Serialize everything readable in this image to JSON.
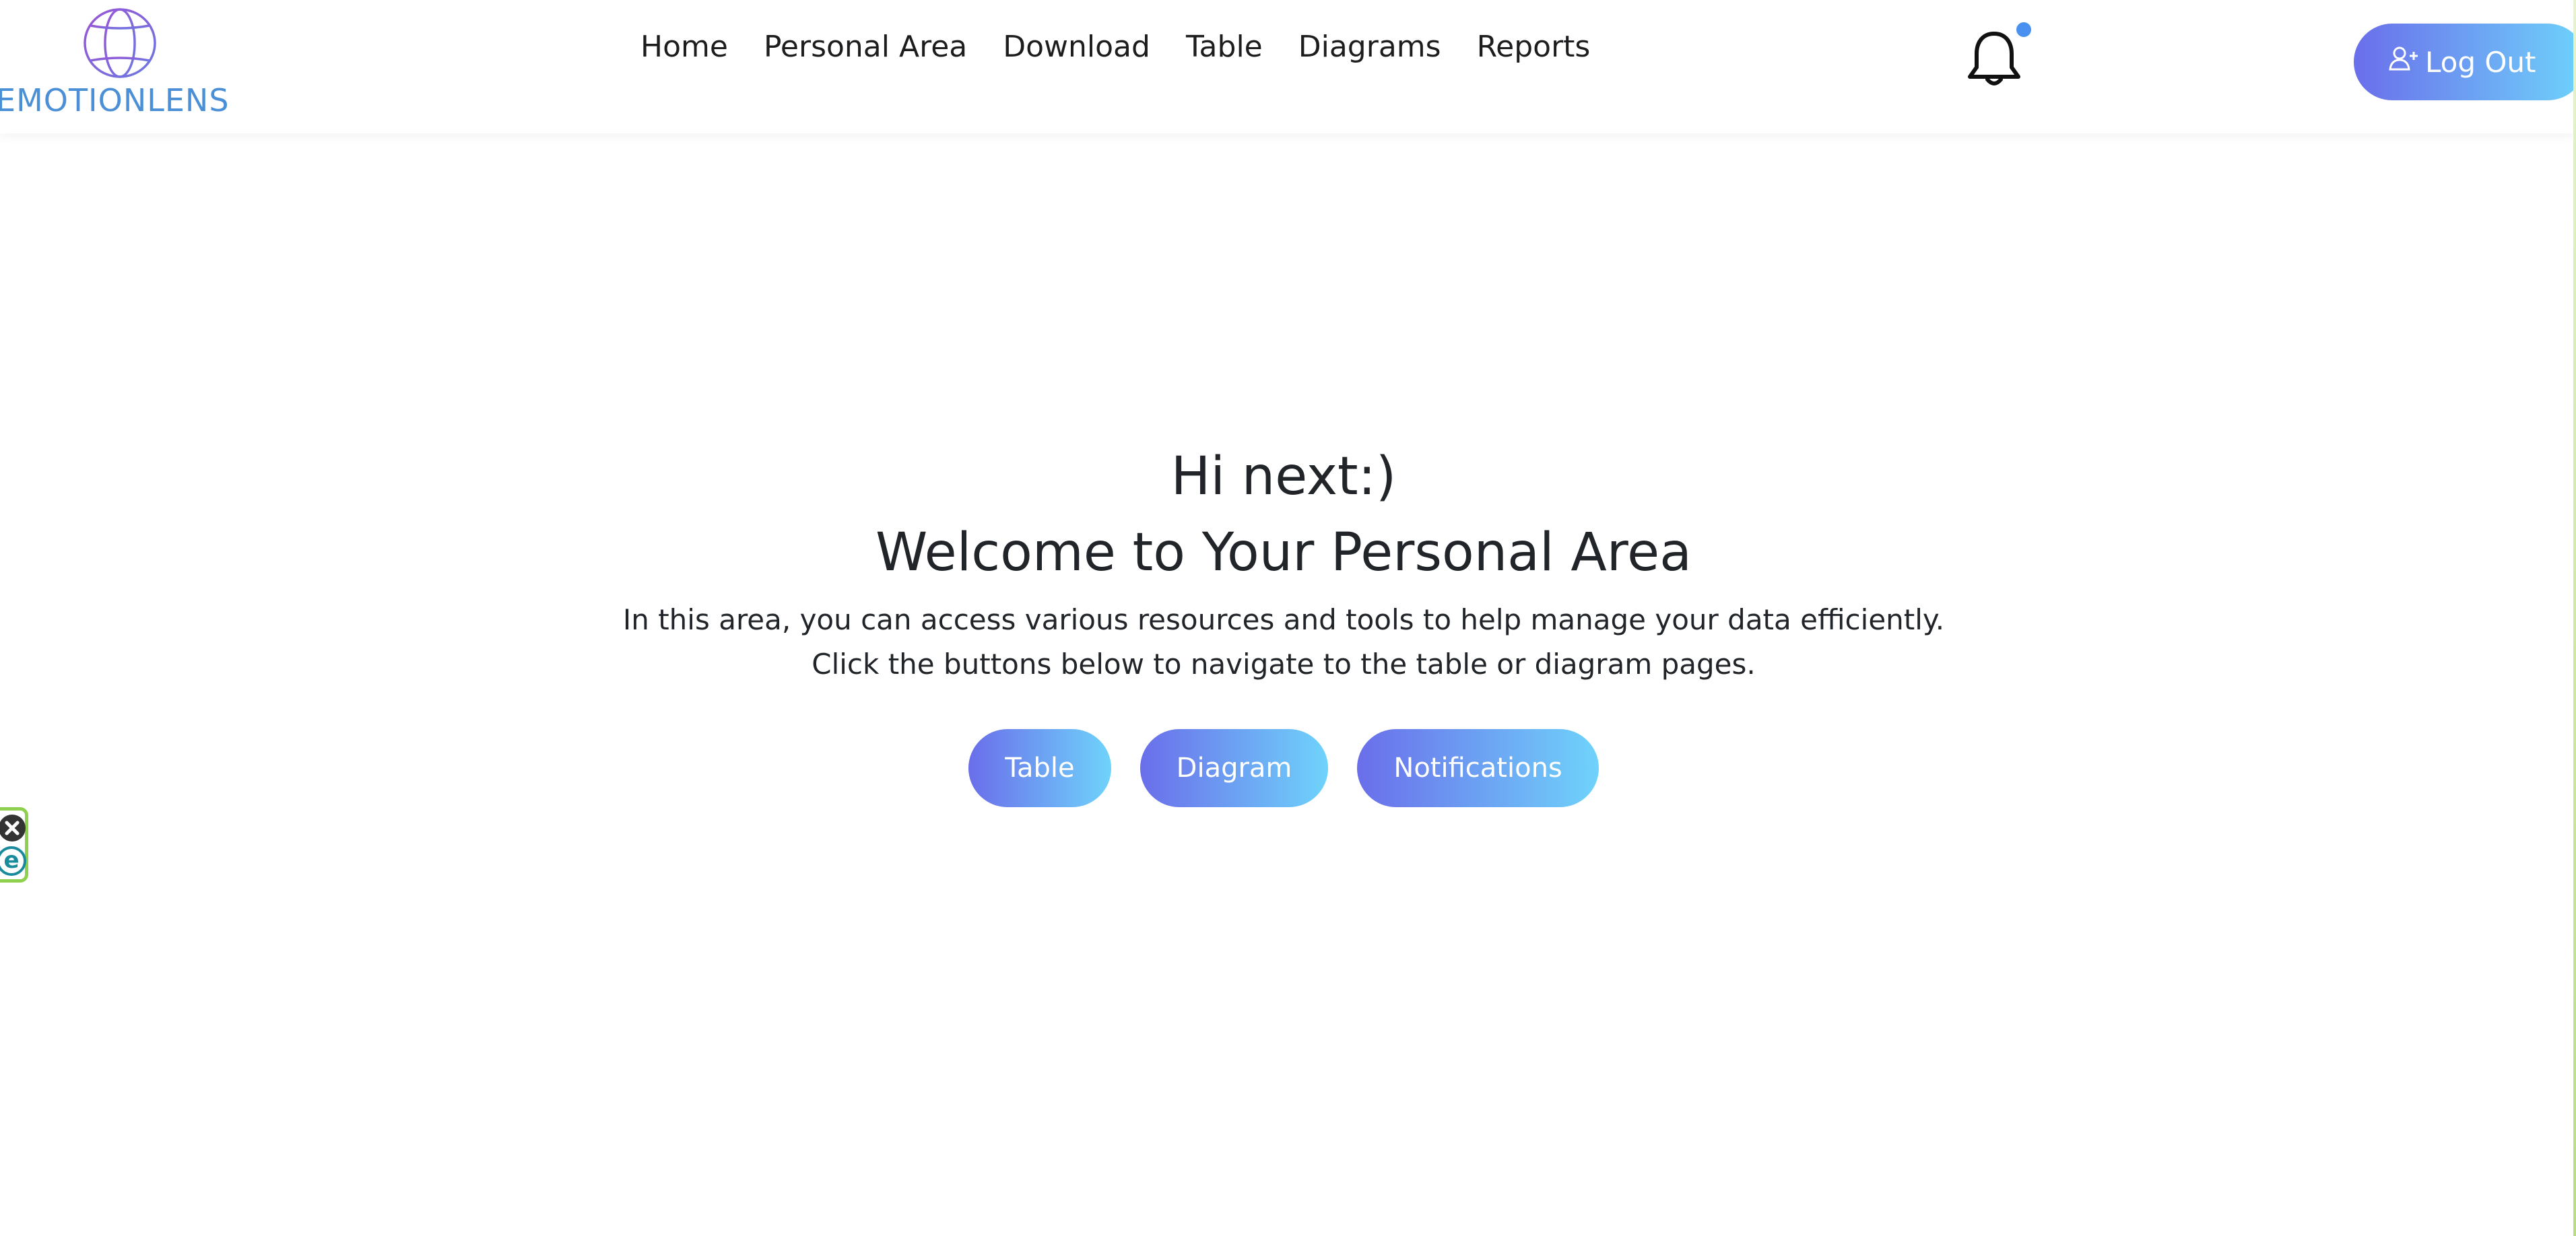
{
  "header": {
    "brand_name": "EMOTIONLENS",
    "brand_logo_icon": "globe-icon",
    "nav": [
      {
        "label": "Home"
      },
      {
        "label": "Personal Area"
      },
      {
        "label": "Download"
      },
      {
        "label": "Table"
      },
      {
        "label": "Diagrams"
      },
      {
        "label": "Reports"
      }
    ],
    "notification_icon": "bell-icon",
    "notification_dot_color": "#4a90f0",
    "logout_label": "Log Out",
    "logout_icon": "user-plus-icon"
  },
  "main": {
    "greeting": "Hi next:)",
    "welcome_title": "Welcome to Your Personal Area",
    "description_line1": "In this area, you can access various resources and tools to help manage your data efficiently.",
    "description_line2": "Click the buttons below to navigate to the table or diagram pages.",
    "buttons": [
      {
        "label": "Table"
      },
      {
        "label": "Diagram"
      },
      {
        "label": "Notifications"
      }
    ]
  },
  "widget": {
    "close_icon": "close-circle-icon",
    "extension_letter": "e"
  },
  "colors": {
    "accent_gradient_start": "#6a6eea",
    "accent_gradient_end": "#6fd3fb",
    "brand_text": "#4b8fd6",
    "brand_logo": "#8b5bd6",
    "widget_border": "#8fd14f"
  }
}
